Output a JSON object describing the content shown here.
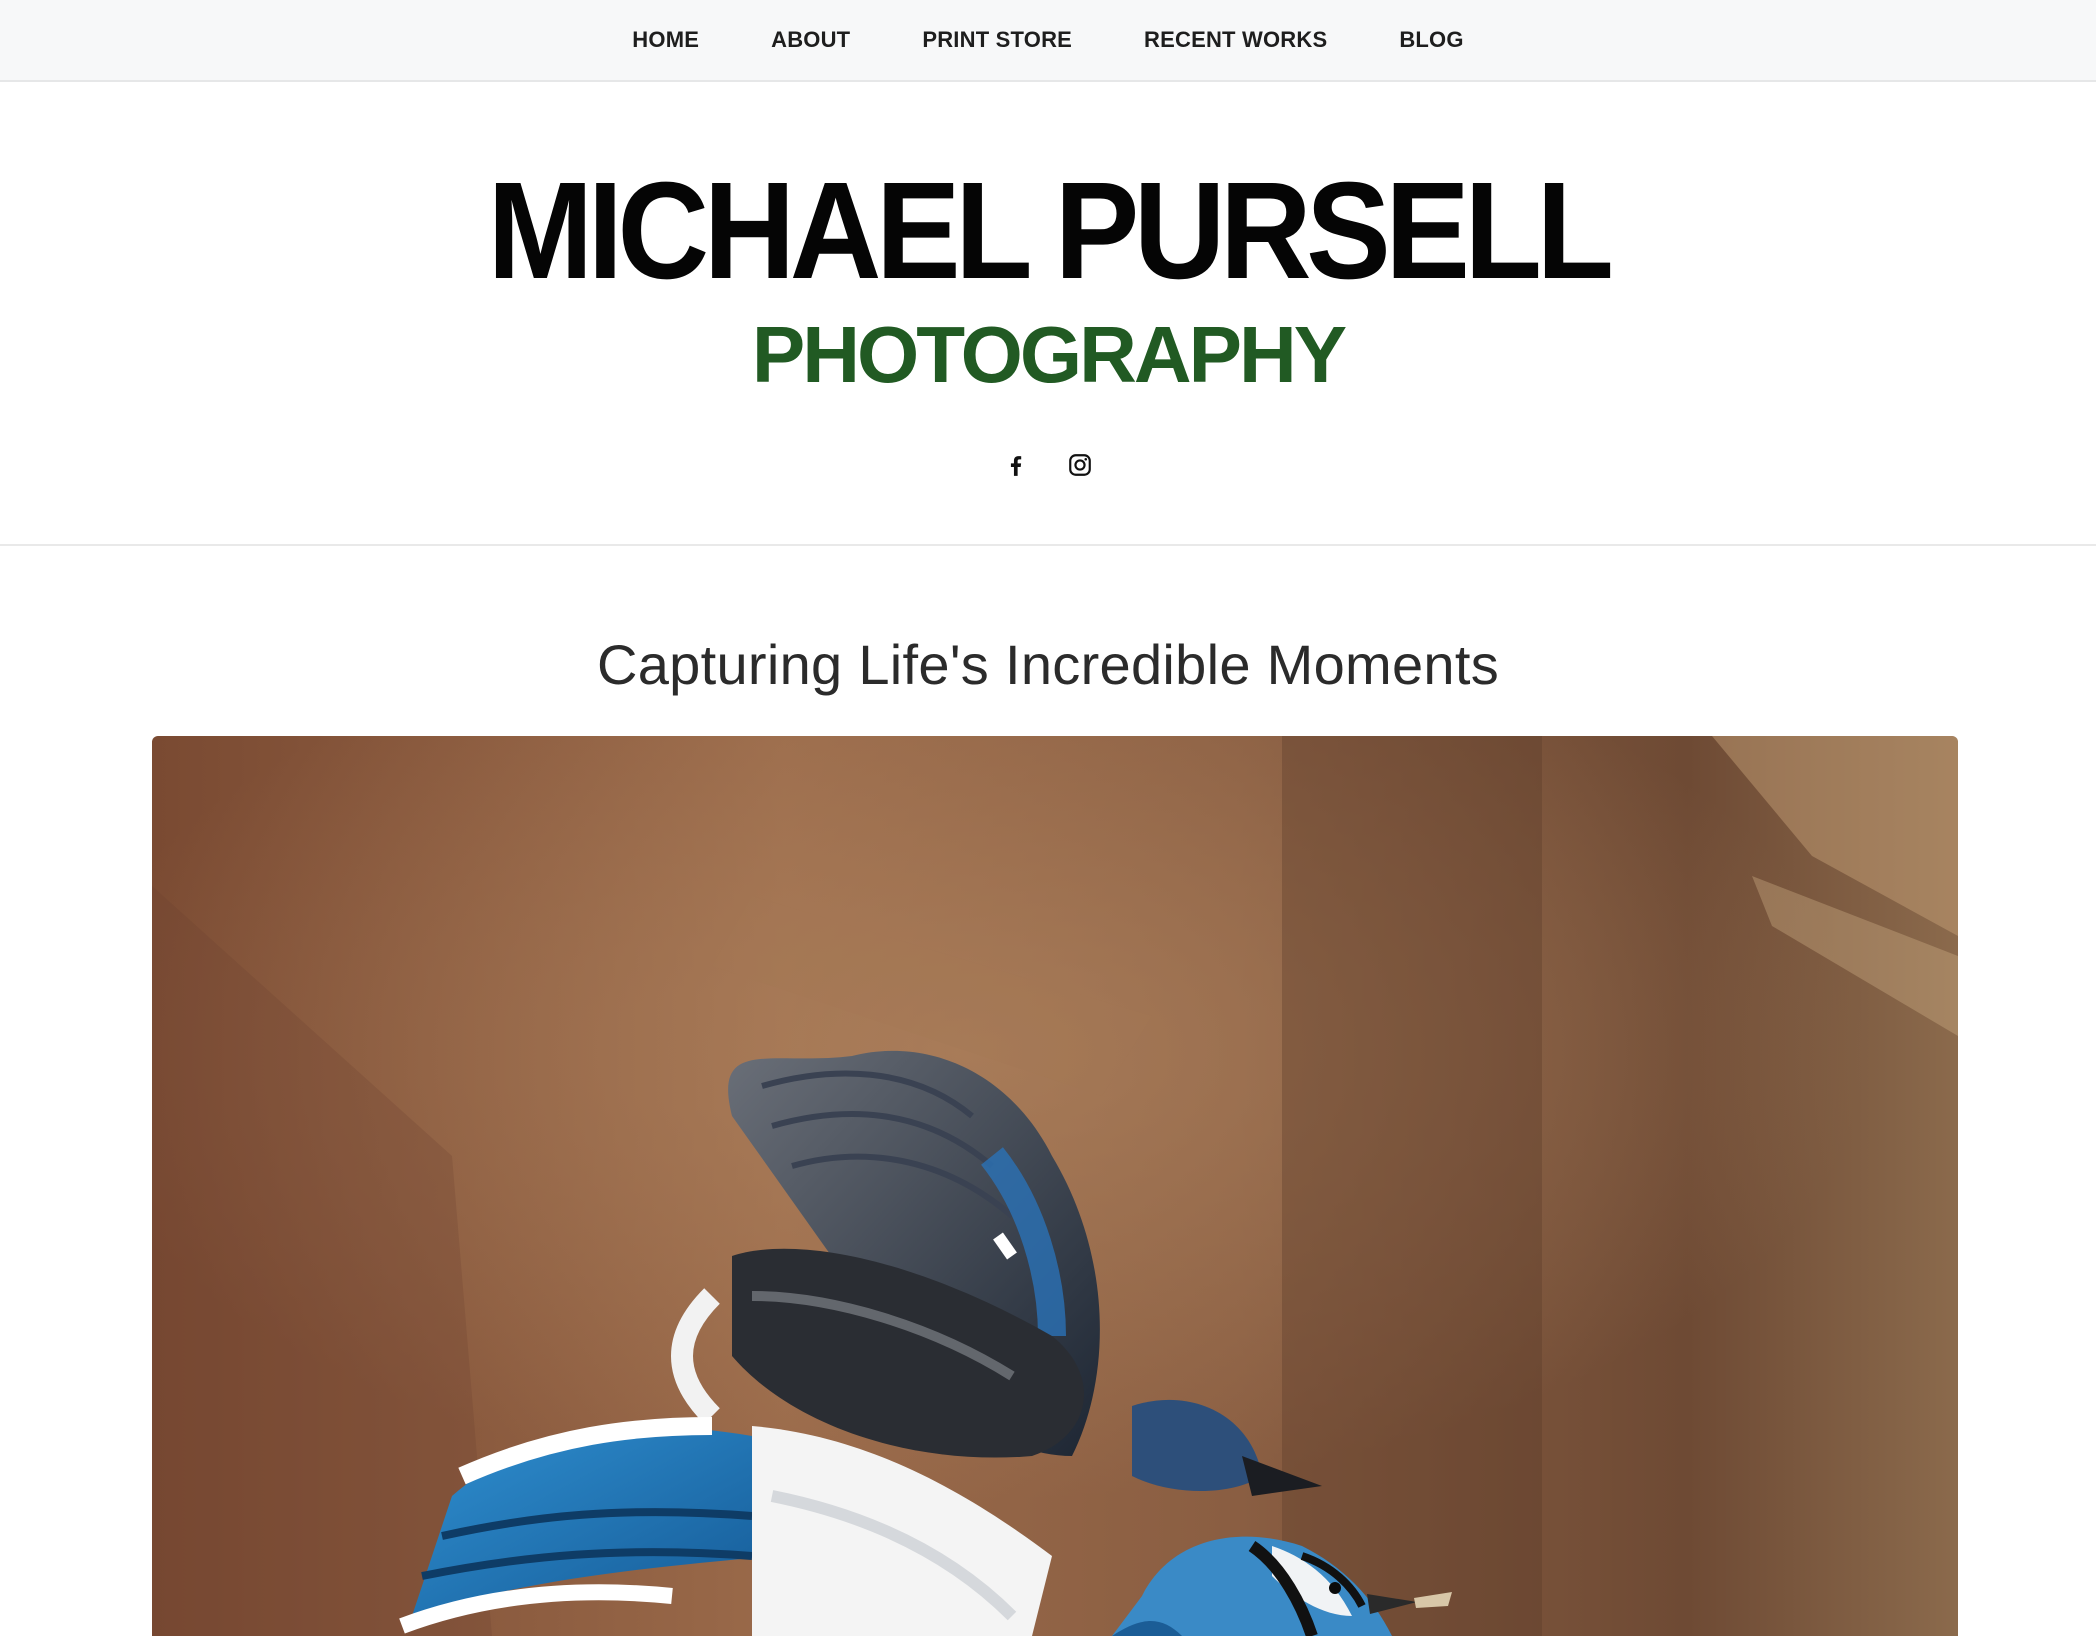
{
  "nav": {
    "items": [
      {
        "label": "HOME"
      },
      {
        "label": "ABOUT"
      },
      {
        "label": "PRINT STORE"
      },
      {
        "label": "RECENT WORKS"
      },
      {
        "label": "BLOG"
      }
    ]
  },
  "brand": {
    "title": "MICHAEL PURSELL",
    "subtitle": "PHOTOGRAPHY",
    "subtitle_color": "#215a23"
  },
  "social": {
    "icons": [
      "facebook-icon",
      "instagram-icon"
    ]
  },
  "hero": {
    "heading": "Capturing Life's Incredible Moments",
    "image_subject": "blue-jay-photo"
  },
  "colors": {
    "nav_bg": "#f7f8f9",
    "title": "#050505",
    "heading": "#2b2b2b"
  }
}
